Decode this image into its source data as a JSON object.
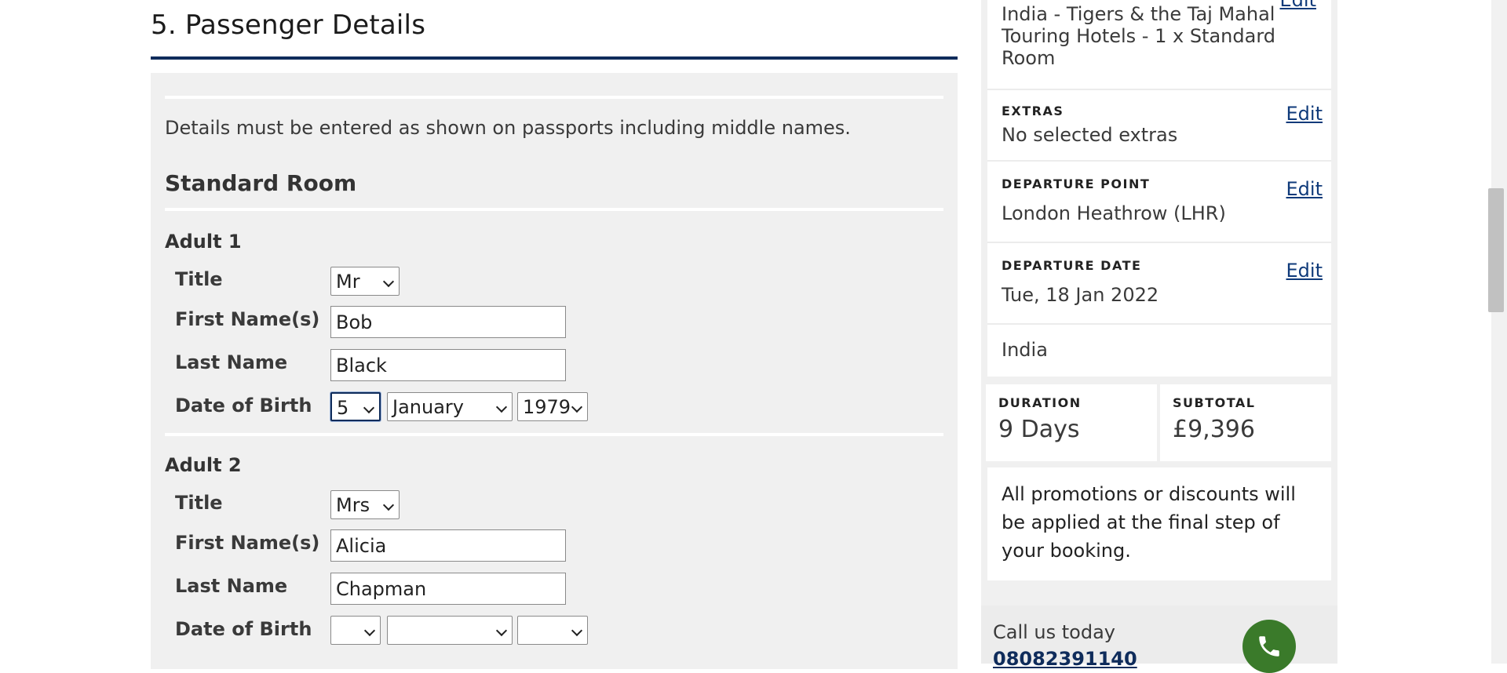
{
  "section": {
    "title": "5. Passenger Details"
  },
  "form": {
    "note": "Details must be entered as shown on passports including middle names.",
    "room_title": "Standard Room",
    "labels": {
      "title": "Title",
      "first_name": "First Name(s)",
      "last_name": "Last Name",
      "dob": "Date of Birth"
    },
    "adults": [
      {
        "heading": "Adult 1",
        "title": "Mr",
        "first_name": "Bob",
        "last_name": "Black",
        "dob_day": "5",
        "dob_month": "January",
        "dob_year": "1979"
      },
      {
        "heading": "Adult 2",
        "title": "Mrs",
        "first_name": "Alicia",
        "last_name": "Chapman",
        "dob_day": "",
        "dob_month": "",
        "dob_year": ""
      }
    ]
  },
  "sidebar": {
    "hotel": {
      "text": "India - Tigers & the Taj Mahal Touring Hotels - 1 x Standard Room",
      "edit": "Edit"
    },
    "extras": {
      "label": "EXTRAS",
      "value": "No selected extras",
      "edit": "Edit"
    },
    "departure_point": {
      "label": "DEPARTURE POINT",
      "value": "London Heathrow (LHR)",
      "edit": "Edit"
    },
    "departure_date": {
      "label": "DEPARTURE DATE",
      "value": "Tue, 18 Jan 2022",
      "edit": "Edit"
    },
    "destination": "India",
    "duration": {
      "label": "DURATION",
      "value": "9 Days"
    },
    "subtotal": {
      "label": "SUBTOTAL",
      "value": "£9,396"
    },
    "promo": "All promotions or discounts will be applied at the final step of your booking.",
    "call": {
      "label": "Call us today",
      "number": "08082391140"
    }
  },
  "colors": {
    "brand_navy": "#0f2c5b",
    "panel_bg": "#f0f0f0",
    "phone_green": "#3a7a2a",
    "link": "#0f3a7a"
  }
}
